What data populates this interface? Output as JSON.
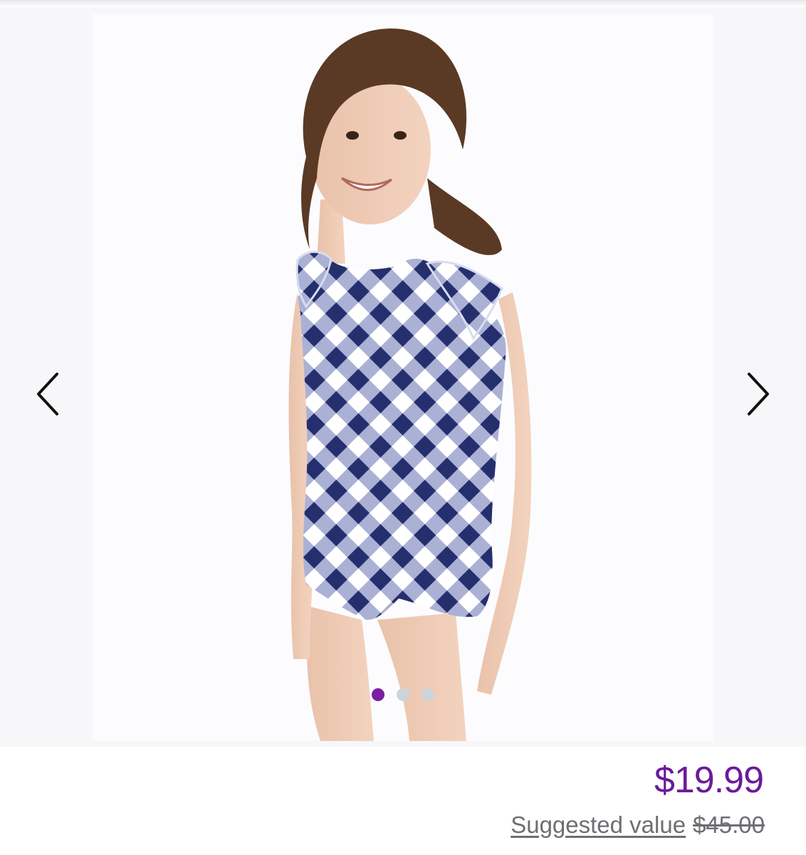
{
  "carousel": {
    "image_alt": "Girl wearing navy and white gingham ruffle swimsuit",
    "slide_count": 3,
    "active_slide": 1,
    "prev_icon": "chevron-left-icon",
    "next_icon": "chevron-right-icon"
  },
  "pricing": {
    "price": "$19.99",
    "suggested_label": "Suggested value",
    "original_price": "$45.00"
  },
  "colors": {
    "price": "#6a1b9a",
    "dot_active": "#7b1fa2",
    "dot_inactive": "#ccd3db",
    "swimsuit_navy": "#262f6e"
  }
}
